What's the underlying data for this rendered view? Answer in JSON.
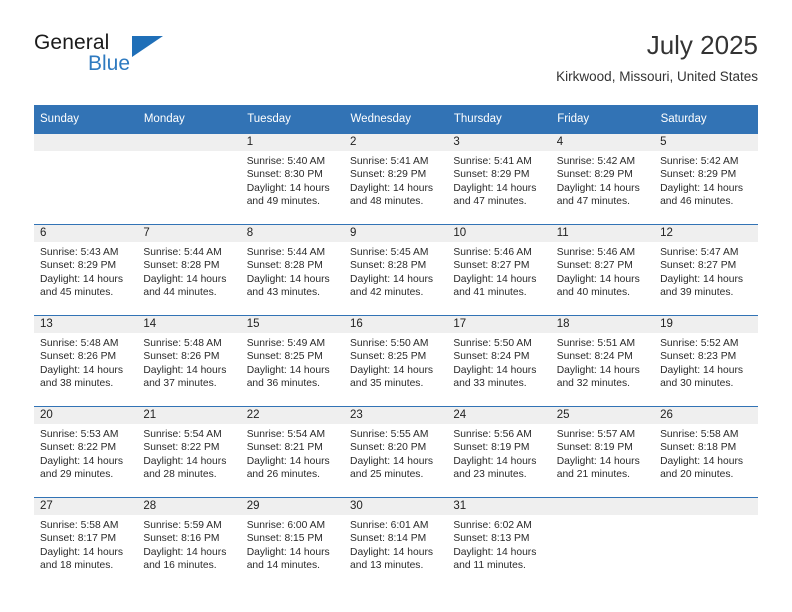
{
  "brand": {
    "name_top": "General",
    "name_bottom": "Blue",
    "triangle_color": "#1f6fb8",
    "blue_text_color": "#2e7ac0"
  },
  "header": {
    "title": "July 2025",
    "subtitle": "Kirkwood, Missouri, United States"
  },
  "theme": {
    "header_blue": "#3273b5",
    "daynum_band": "#efefef",
    "text": "#222222"
  },
  "weekday_headers": [
    "Sunday",
    "Monday",
    "Tuesday",
    "Wednesday",
    "Thursday",
    "Friday",
    "Saturday"
  ],
  "labels": {
    "sunrise_prefix": "Sunrise:",
    "sunset_prefix": "Sunset:",
    "daylight_prefix": "Daylight:"
  },
  "weeks": [
    [
      {
        "day": "",
        "sunrise": "",
        "sunset": "",
        "daylight_line1": "",
        "daylight_line2": ""
      },
      {
        "day": "",
        "sunrise": "",
        "sunset": "",
        "daylight_line1": "",
        "daylight_line2": ""
      },
      {
        "day": "1",
        "sunrise": "Sunrise: 5:40 AM",
        "sunset": "Sunset: 8:30 PM",
        "daylight_line1": "Daylight: 14 hours",
        "daylight_line2": "and 49 minutes."
      },
      {
        "day": "2",
        "sunrise": "Sunrise: 5:41 AM",
        "sunset": "Sunset: 8:29 PM",
        "daylight_line1": "Daylight: 14 hours",
        "daylight_line2": "and 48 minutes."
      },
      {
        "day": "3",
        "sunrise": "Sunrise: 5:41 AM",
        "sunset": "Sunset: 8:29 PM",
        "daylight_line1": "Daylight: 14 hours",
        "daylight_line2": "and 47 minutes."
      },
      {
        "day": "4",
        "sunrise": "Sunrise: 5:42 AM",
        "sunset": "Sunset: 8:29 PM",
        "daylight_line1": "Daylight: 14 hours",
        "daylight_line2": "and 47 minutes."
      },
      {
        "day": "5",
        "sunrise": "Sunrise: 5:42 AM",
        "sunset": "Sunset: 8:29 PM",
        "daylight_line1": "Daylight: 14 hours",
        "daylight_line2": "and 46 minutes."
      }
    ],
    [
      {
        "day": "6",
        "sunrise": "Sunrise: 5:43 AM",
        "sunset": "Sunset: 8:29 PM",
        "daylight_line1": "Daylight: 14 hours",
        "daylight_line2": "and 45 minutes."
      },
      {
        "day": "7",
        "sunrise": "Sunrise: 5:44 AM",
        "sunset": "Sunset: 8:28 PM",
        "daylight_line1": "Daylight: 14 hours",
        "daylight_line2": "and 44 minutes."
      },
      {
        "day": "8",
        "sunrise": "Sunrise: 5:44 AM",
        "sunset": "Sunset: 8:28 PM",
        "daylight_line1": "Daylight: 14 hours",
        "daylight_line2": "and 43 minutes."
      },
      {
        "day": "9",
        "sunrise": "Sunrise: 5:45 AM",
        "sunset": "Sunset: 8:28 PM",
        "daylight_line1": "Daylight: 14 hours",
        "daylight_line2": "and 42 minutes."
      },
      {
        "day": "10",
        "sunrise": "Sunrise: 5:46 AM",
        "sunset": "Sunset: 8:27 PM",
        "daylight_line1": "Daylight: 14 hours",
        "daylight_line2": "and 41 minutes."
      },
      {
        "day": "11",
        "sunrise": "Sunrise: 5:46 AM",
        "sunset": "Sunset: 8:27 PM",
        "daylight_line1": "Daylight: 14 hours",
        "daylight_line2": "and 40 minutes."
      },
      {
        "day": "12",
        "sunrise": "Sunrise: 5:47 AM",
        "sunset": "Sunset: 8:27 PM",
        "daylight_line1": "Daylight: 14 hours",
        "daylight_line2": "and 39 minutes."
      }
    ],
    [
      {
        "day": "13",
        "sunrise": "Sunrise: 5:48 AM",
        "sunset": "Sunset: 8:26 PM",
        "daylight_line1": "Daylight: 14 hours",
        "daylight_line2": "and 38 minutes."
      },
      {
        "day": "14",
        "sunrise": "Sunrise: 5:48 AM",
        "sunset": "Sunset: 8:26 PM",
        "daylight_line1": "Daylight: 14 hours",
        "daylight_line2": "and 37 minutes."
      },
      {
        "day": "15",
        "sunrise": "Sunrise: 5:49 AM",
        "sunset": "Sunset: 8:25 PM",
        "daylight_line1": "Daylight: 14 hours",
        "daylight_line2": "and 36 minutes."
      },
      {
        "day": "16",
        "sunrise": "Sunrise: 5:50 AM",
        "sunset": "Sunset: 8:25 PM",
        "daylight_line1": "Daylight: 14 hours",
        "daylight_line2": "and 35 minutes."
      },
      {
        "day": "17",
        "sunrise": "Sunrise: 5:50 AM",
        "sunset": "Sunset: 8:24 PM",
        "daylight_line1": "Daylight: 14 hours",
        "daylight_line2": "and 33 minutes."
      },
      {
        "day": "18",
        "sunrise": "Sunrise: 5:51 AM",
        "sunset": "Sunset: 8:24 PM",
        "daylight_line1": "Daylight: 14 hours",
        "daylight_line2": "and 32 minutes."
      },
      {
        "day": "19",
        "sunrise": "Sunrise: 5:52 AM",
        "sunset": "Sunset: 8:23 PM",
        "daylight_line1": "Daylight: 14 hours",
        "daylight_line2": "and 30 minutes."
      }
    ],
    [
      {
        "day": "20",
        "sunrise": "Sunrise: 5:53 AM",
        "sunset": "Sunset: 8:22 PM",
        "daylight_line1": "Daylight: 14 hours",
        "daylight_line2": "and 29 minutes."
      },
      {
        "day": "21",
        "sunrise": "Sunrise: 5:54 AM",
        "sunset": "Sunset: 8:22 PM",
        "daylight_line1": "Daylight: 14 hours",
        "daylight_line2": "and 28 minutes."
      },
      {
        "day": "22",
        "sunrise": "Sunrise: 5:54 AM",
        "sunset": "Sunset: 8:21 PM",
        "daylight_line1": "Daylight: 14 hours",
        "daylight_line2": "and 26 minutes."
      },
      {
        "day": "23",
        "sunrise": "Sunrise: 5:55 AM",
        "sunset": "Sunset: 8:20 PM",
        "daylight_line1": "Daylight: 14 hours",
        "daylight_line2": "and 25 minutes."
      },
      {
        "day": "24",
        "sunrise": "Sunrise: 5:56 AM",
        "sunset": "Sunset: 8:19 PM",
        "daylight_line1": "Daylight: 14 hours",
        "daylight_line2": "and 23 minutes."
      },
      {
        "day": "25",
        "sunrise": "Sunrise: 5:57 AM",
        "sunset": "Sunset: 8:19 PM",
        "daylight_line1": "Daylight: 14 hours",
        "daylight_line2": "and 21 minutes."
      },
      {
        "day": "26",
        "sunrise": "Sunrise: 5:58 AM",
        "sunset": "Sunset: 8:18 PM",
        "daylight_line1": "Daylight: 14 hours",
        "daylight_line2": "and 20 minutes."
      }
    ],
    [
      {
        "day": "27",
        "sunrise": "Sunrise: 5:58 AM",
        "sunset": "Sunset: 8:17 PM",
        "daylight_line1": "Daylight: 14 hours",
        "daylight_line2": "and 18 minutes."
      },
      {
        "day": "28",
        "sunrise": "Sunrise: 5:59 AM",
        "sunset": "Sunset: 8:16 PM",
        "daylight_line1": "Daylight: 14 hours",
        "daylight_line2": "and 16 minutes."
      },
      {
        "day": "29",
        "sunrise": "Sunrise: 6:00 AM",
        "sunset": "Sunset: 8:15 PM",
        "daylight_line1": "Daylight: 14 hours",
        "daylight_line2": "and 14 minutes."
      },
      {
        "day": "30",
        "sunrise": "Sunrise: 6:01 AM",
        "sunset": "Sunset: 8:14 PM",
        "daylight_line1": "Daylight: 14 hours",
        "daylight_line2": "and 13 minutes."
      },
      {
        "day": "31",
        "sunrise": "Sunrise: 6:02 AM",
        "sunset": "Sunset: 8:13 PM",
        "daylight_line1": "Daylight: 14 hours",
        "daylight_line2": "and 11 minutes."
      },
      {
        "day": "",
        "sunrise": "",
        "sunset": "",
        "daylight_line1": "",
        "daylight_line2": ""
      },
      {
        "day": "",
        "sunrise": "",
        "sunset": "",
        "daylight_line1": "",
        "daylight_line2": ""
      }
    ]
  ]
}
